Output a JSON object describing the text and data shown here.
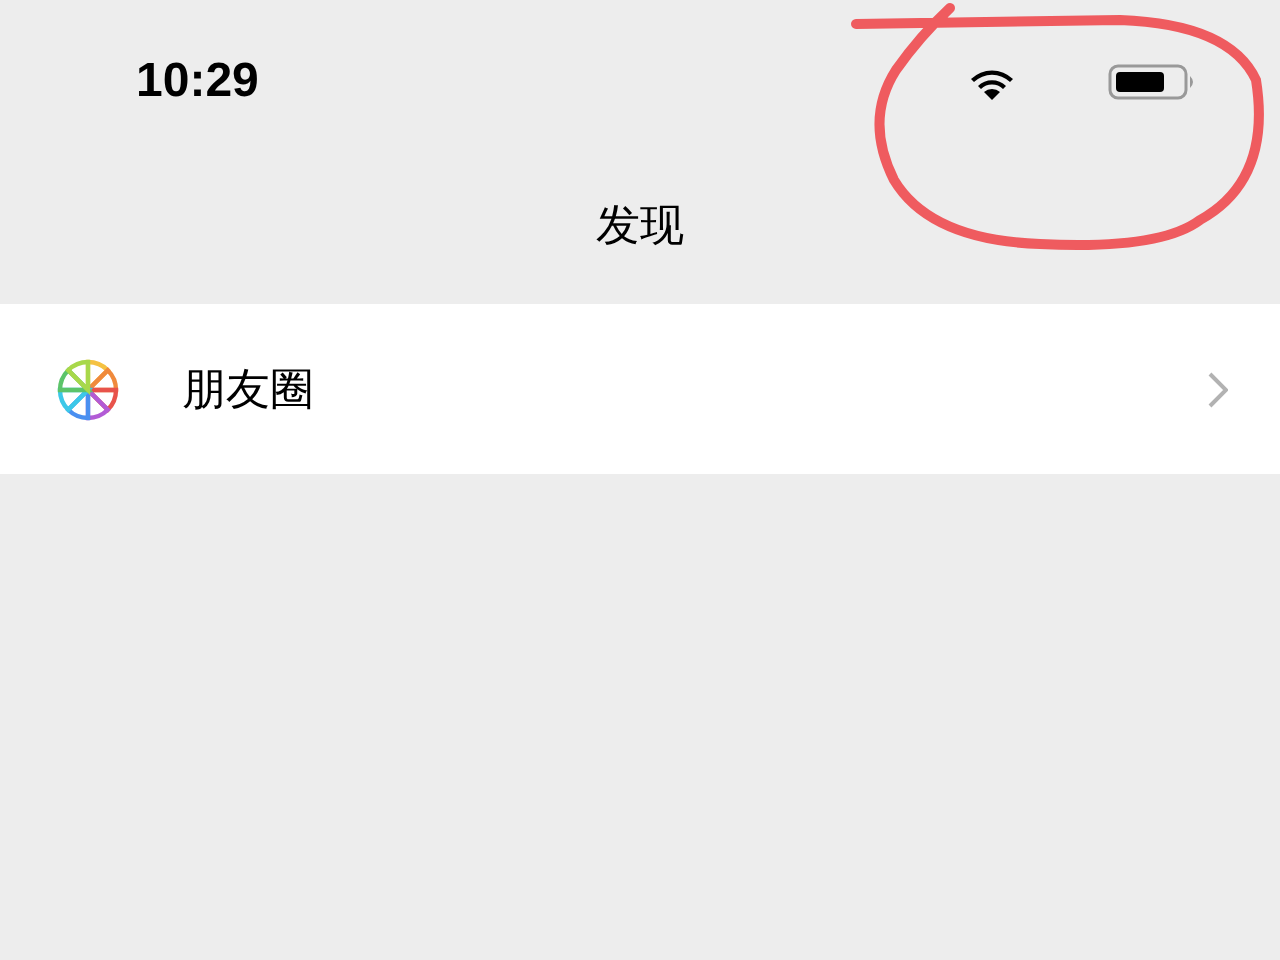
{
  "status_bar": {
    "time": "10:29"
  },
  "nav_bar": {
    "title": "发现"
  },
  "list": {
    "items": [
      {
        "label": "朋友圈"
      }
    ]
  },
  "annotation": {
    "kind": "circle"
  }
}
